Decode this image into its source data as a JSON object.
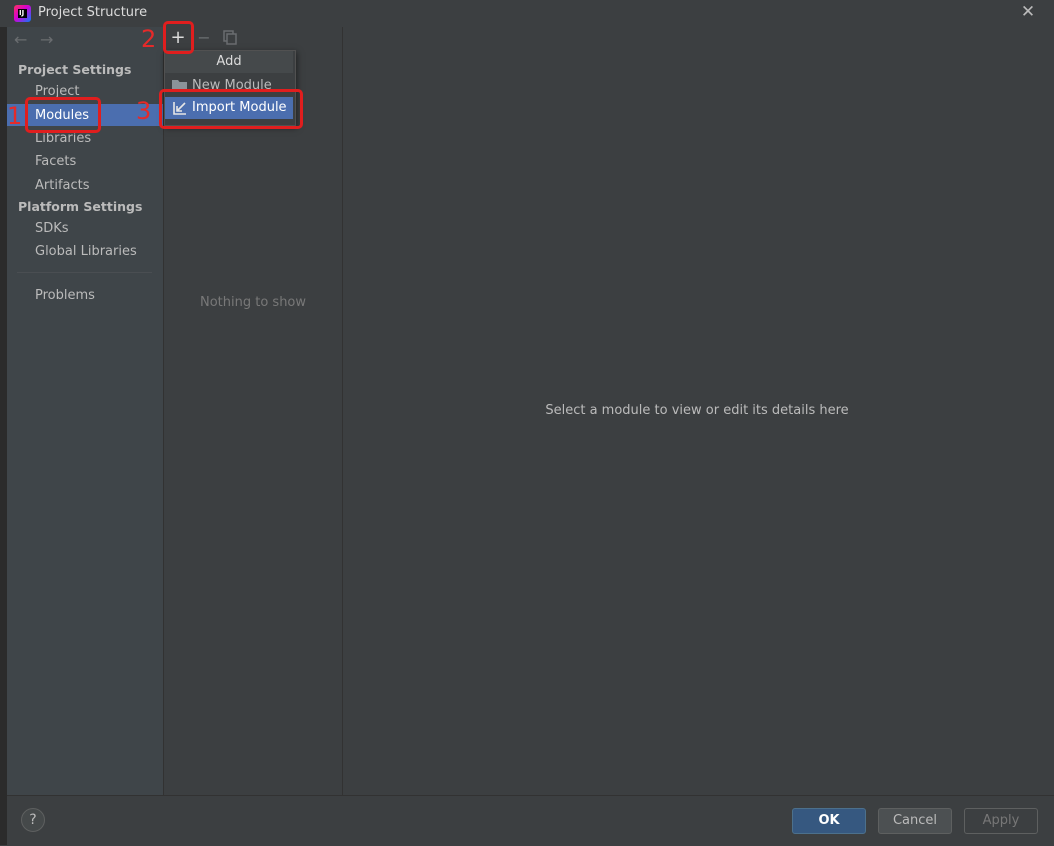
{
  "window": {
    "title": "Project Structure",
    "logo_text": "IJ"
  },
  "nav": {
    "back_icon": "arrow-left-icon",
    "forward_icon": "arrow-right-icon",
    "project_settings_label": "Project Settings",
    "platform_settings_label": "Platform Settings",
    "items": {
      "project": "Project",
      "modules": "Modules",
      "libraries": "Libraries",
      "facets": "Facets",
      "artifacts": "Artifacts",
      "sdks": "SDKs",
      "global_libraries": "Global Libraries",
      "problems": "Problems"
    },
    "selected": "Modules"
  },
  "list_panel": {
    "toolbar": {
      "add": "+",
      "remove": "−"
    },
    "empty_text": "Nothing to show"
  },
  "popup": {
    "title": "Add",
    "items": [
      "New Module",
      "Import Module"
    ],
    "highlighted": "Import Module"
  },
  "details": {
    "empty_text": "Select a module to view or edit its details here"
  },
  "footer": {
    "help": "?",
    "ok": "OK",
    "cancel": "Cancel",
    "apply": "Apply"
  },
  "annotations": [
    "1",
    "2",
    "3"
  ],
  "colors": {
    "accent": "#4b6eaf",
    "annotation": "#e01e1e",
    "background": "#3c3f41"
  }
}
